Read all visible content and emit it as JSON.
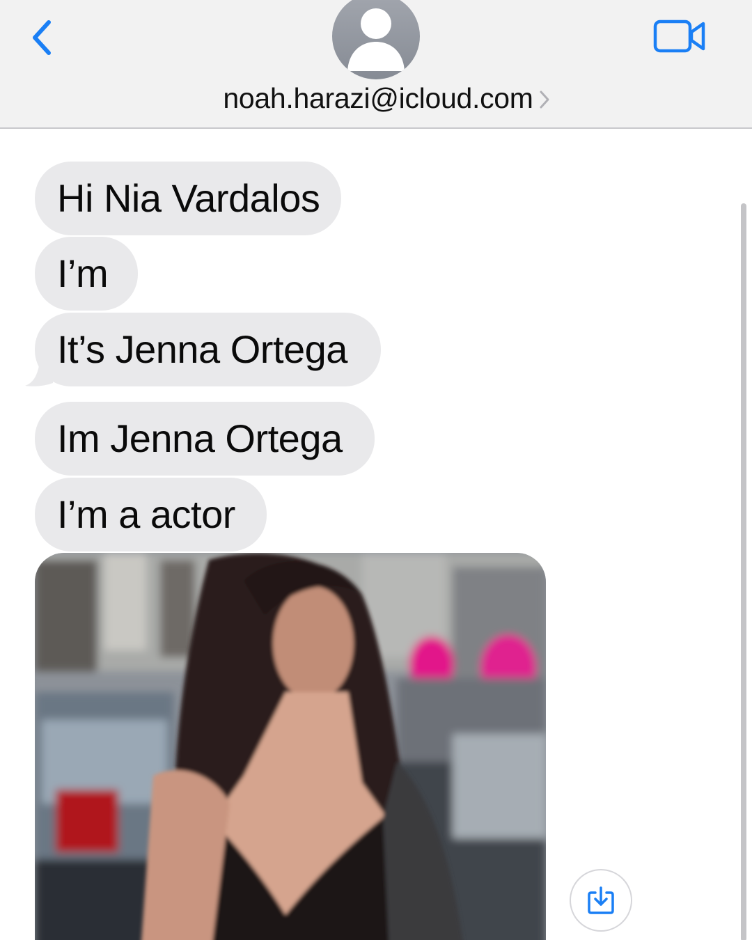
{
  "header": {
    "contact_name": "noah.harazi@icloud.com",
    "icons": {
      "back": "chevron-left-icon",
      "avatar": "person-icon",
      "chevron": "chevron-right-icon",
      "video": "video-camera-icon"
    },
    "accent_color": "#1a7ff5"
  },
  "messages": [
    {
      "text": "Hi Nia Vardalos"
    },
    {
      "text": "I’m"
    },
    {
      "text": "It’s Jenna Ortega"
    },
    {
      "text": "Im Jenna Ortega"
    },
    {
      "text": "I’m a actor"
    }
  ],
  "attachment": {
    "type": "photo",
    "save_icon": "save-download-icon"
  },
  "colors": {
    "incoming_bubble": "#e9e9eb",
    "header_background": "#f2f2f2"
  }
}
